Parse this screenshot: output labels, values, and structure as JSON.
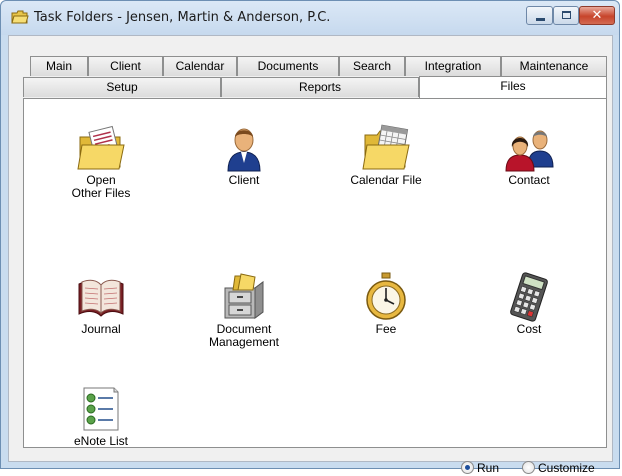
{
  "window": {
    "title": "Task Folders - Jensen, Martin & Anderson, P.C.",
    "close_glyph": "✕"
  },
  "tabs": {
    "row1": [
      "Main",
      "Client",
      "Calendar",
      "Documents",
      "Search",
      "Integration",
      "Maintenance"
    ],
    "row2": [
      "Setup",
      "Reports",
      "Files"
    ],
    "active": "Files"
  },
  "items": [
    {
      "label1": "Open",
      "label2": "Other Files",
      "icon": "folder-document-icon"
    },
    {
      "label1": "Client",
      "label2": "",
      "icon": "person-icon"
    },
    {
      "label1": "Calendar File",
      "label2": "",
      "icon": "calendar-folder-icon"
    },
    {
      "label1": "Contact",
      "label2": "",
      "icon": "contacts-icon"
    },
    {
      "label1": "Journal",
      "label2": "",
      "icon": "journal-book-icon"
    },
    {
      "label1": "Document",
      "label2": "Management",
      "icon": "file-cabinet-icon"
    },
    {
      "label1": "Fee",
      "label2": "",
      "icon": "stopwatch-icon"
    },
    {
      "label1": "Cost",
      "label2": "",
      "icon": "calculator-icon"
    },
    {
      "label1": "eNote List",
      "label2": "",
      "icon": "checklist-icon"
    }
  ],
  "mode": {
    "run_label": "Run",
    "customize_label": "Customize",
    "selected": "Run"
  }
}
